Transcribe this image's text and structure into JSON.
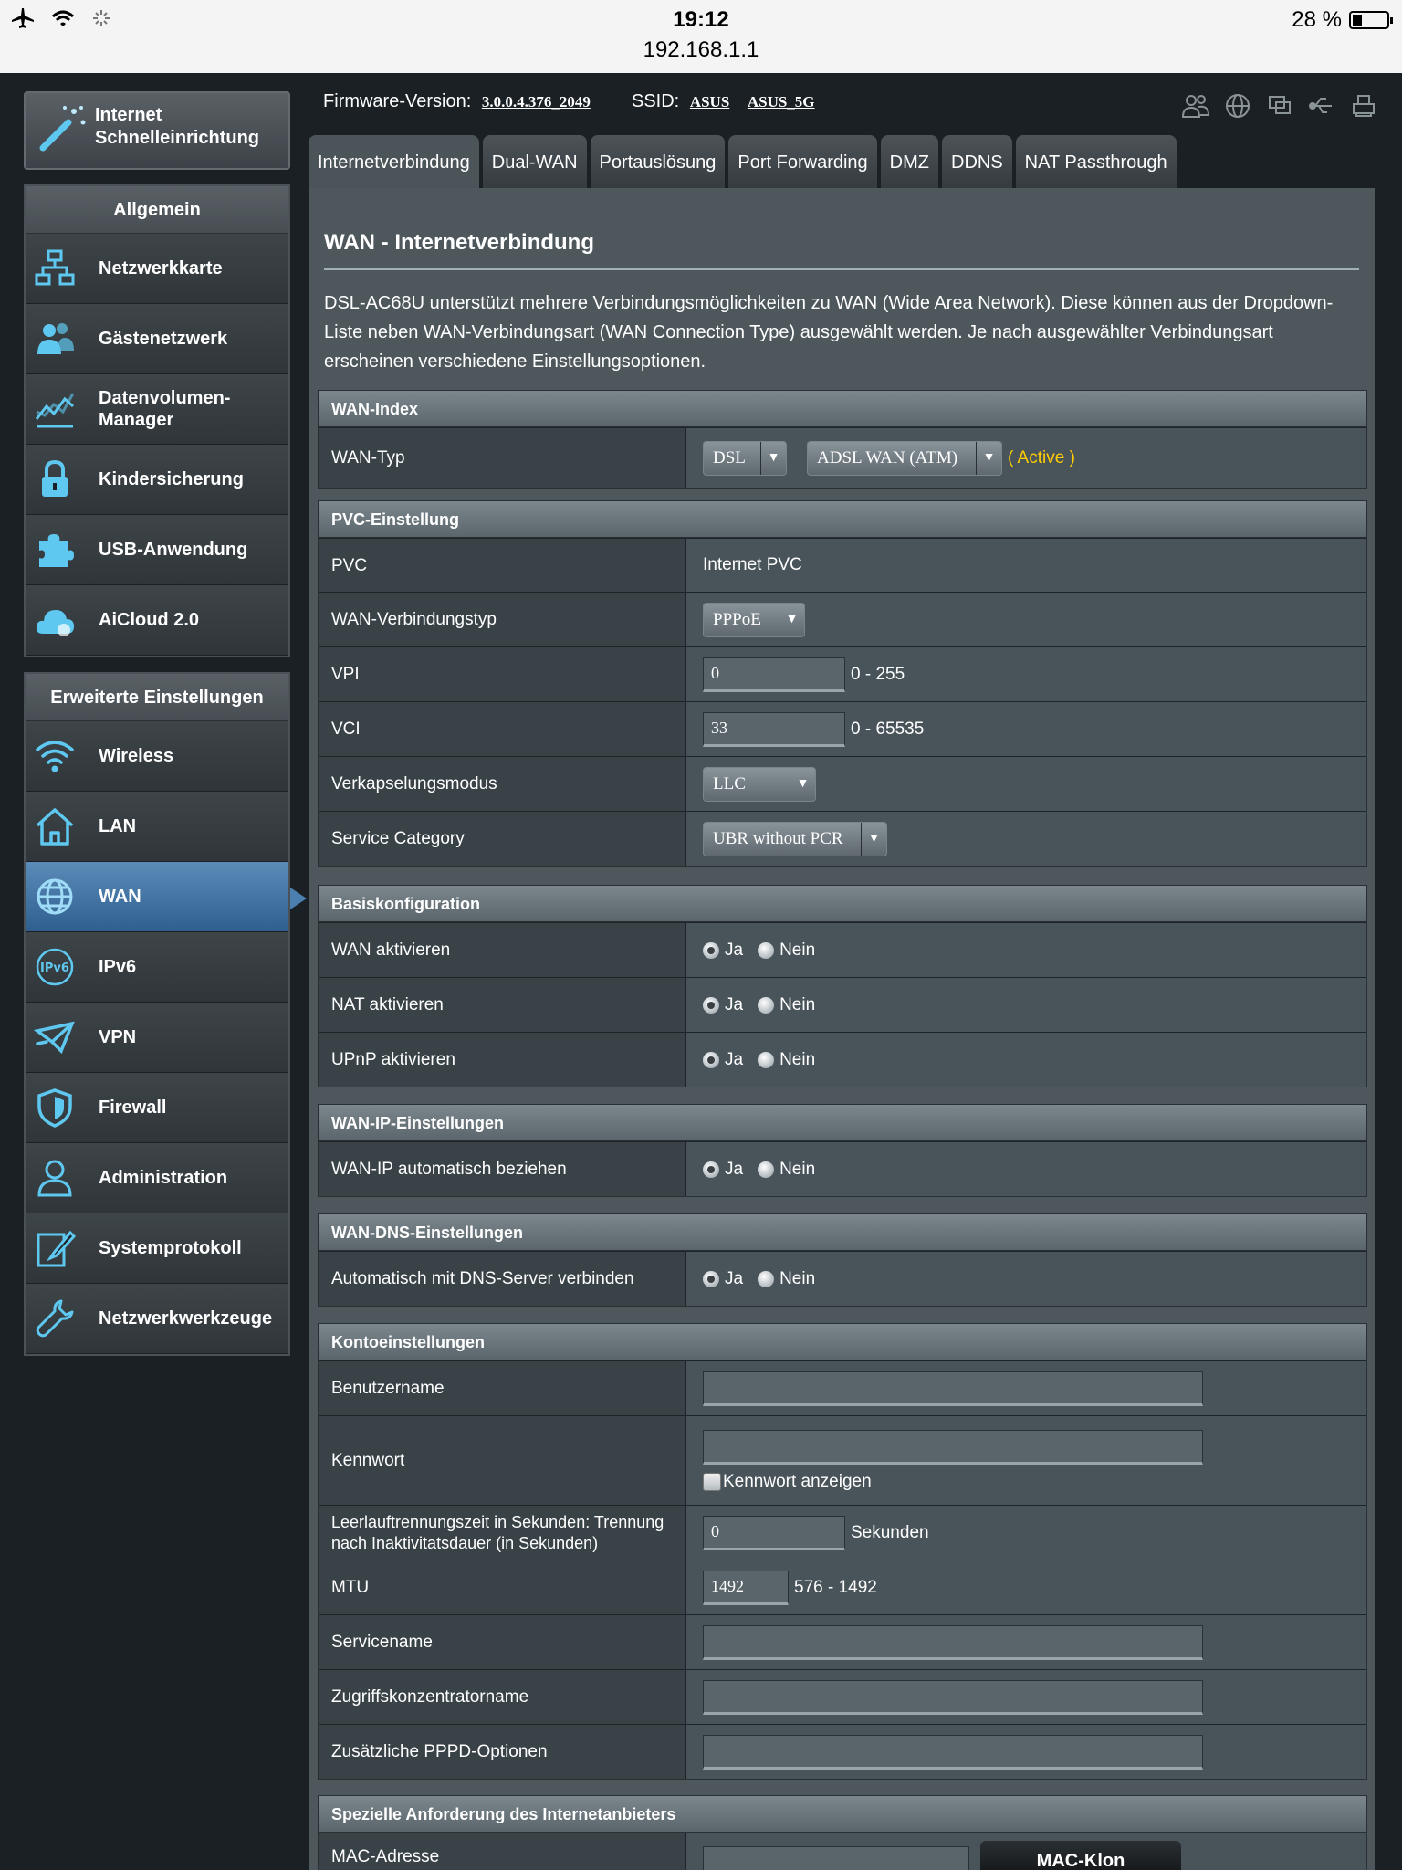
{
  "status_bar": {
    "time": "19:12",
    "url": "192.168.1.1",
    "battery": "28 %",
    "icons": [
      "airplane-icon",
      "wifi-icon",
      "loading-icon",
      "battery-icon"
    ]
  },
  "quick_setup": {
    "label": "Internet Schnelleinrichtung"
  },
  "sidebar": {
    "general_header": "Allgemein",
    "general_items": [
      {
        "label": "Netzwerkkarte",
        "icon": "network-map-icon"
      },
      {
        "label": "Gästenetzwerk",
        "icon": "guest-network-icon"
      },
      {
        "label": "Datenvolumen-Manager",
        "icon": "traffic-manager-icon"
      },
      {
        "label": "Kindersicherung",
        "icon": "lock-icon"
      },
      {
        "label": "USB-Anwendung",
        "icon": "puzzle-icon"
      },
      {
        "label": "AiCloud 2.0",
        "icon": "cloud-icon"
      }
    ],
    "advanced_header": "Erweiterte Einstellungen",
    "advanced_items": [
      {
        "label": "Wireless",
        "icon": "wifi-icon"
      },
      {
        "label": "LAN",
        "icon": "home-icon"
      },
      {
        "label": "WAN",
        "icon": "globe-icon",
        "active": true
      },
      {
        "label": "IPv6",
        "icon": "ipv6-icon"
      },
      {
        "label": "VPN",
        "icon": "vpn-icon"
      },
      {
        "label": "Firewall",
        "icon": "shield-icon"
      },
      {
        "label": "Administration",
        "icon": "admin-user-icon"
      },
      {
        "label": "Systemprotokoll",
        "icon": "log-edit-icon"
      },
      {
        "label": "Netzwerkwerkzeuge",
        "icon": "wrench-icon"
      }
    ]
  },
  "header": {
    "firmware_label": "Firmware-Version:",
    "firmware_value": "3.0.0.4.376_2049",
    "ssid_label": "SSID:",
    "ssid_1": "ASUS",
    "ssid_2": "ASUS_5G",
    "icons": [
      "clients-icon",
      "internet-status-icon",
      "devices-icon",
      "usb-icon",
      "printer-icon"
    ]
  },
  "tabs": [
    "Internetverbindung",
    "Dual-WAN",
    "Portauslösung",
    "Port Forwarding",
    "DMZ",
    "DDNS",
    "NAT Passthrough"
  ],
  "main": {
    "title": "WAN - Internetverbindung",
    "description": "DSL-AC68U unterstützt mehrere Verbindungsmöglichkeiten zu WAN (Wide Area Network). Diese können aus der Dropdown-Liste neben WAN-Verbindungsart (WAN Connection Type) ausgewählt werden. Je nach ausgewählter Verbindungsart erscheinen verschiedene Einstellungsoptionen.",
    "wan_index": {
      "header": "WAN-Index",
      "wan_type_label": "WAN-Typ",
      "wan_type_value": "DSL",
      "wan_mode_value": "ADSL WAN (ATM)",
      "active_text": "( Active )"
    },
    "pvc": {
      "header": "PVC-Einstellung",
      "pvc_label": "PVC",
      "pvc_value": "Internet PVC",
      "conn_type_label": "WAN-Verbindungstyp",
      "conn_type_value": "PPPoE",
      "vpi_label": "VPI",
      "vpi_value": "0",
      "vpi_range": "0 - 255",
      "vci_label": "VCI",
      "vci_value": "33",
      "vci_range": "0 - 65535",
      "encap_label": "Verkapselungsmodus",
      "encap_value": "LLC",
      "service_cat_label": "Service Category",
      "service_cat_value": "UBR without PCR"
    },
    "basic": {
      "header": "Basiskonfiguration",
      "yes": "Ja",
      "no": "Nein",
      "wan_enable_label": "WAN aktivieren",
      "nat_enable_label": "NAT aktivieren",
      "upnp_enable_label": "UPnP aktivieren"
    },
    "wan_ip": {
      "header": "WAN-IP-Einstellungen",
      "auto_label": "WAN-IP automatisch beziehen"
    },
    "wan_dns": {
      "header": "WAN-DNS-Einstellungen",
      "auto_label": "Automatisch mit DNS-Server verbinden"
    },
    "account": {
      "header": "Kontoeinstellungen",
      "username_label": "Benutzername",
      "username_value": "",
      "password_label": "Kennwort",
      "password_value": "",
      "show_password_label": "Kennwort anzeigen",
      "idle_label": "Leerlauftrennungszeit in Sekunden: Trennung nach Inaktivitatsdauer (in Sekunden)",
      "idle_value": "0",
      "idle_unit": "Sekunden",
      "mtu_label": "MTU",
      "mtu_value": "1492",
      "mtu_range": "576 - 1492",
      "service_name_label": "Servicename",
      "ac_name_label": "Zugriffskonzentratorname",
      "pppd_label": "Zusätzliche PPPD-Optionen"
    },
    "isp": {
      "header": "Spezielle Anforderung des Internetanbieters",
      "mac_label": "MAC-Adresse",
      "mac_clone_button": "MAC-Klon"
    }
  }
}
